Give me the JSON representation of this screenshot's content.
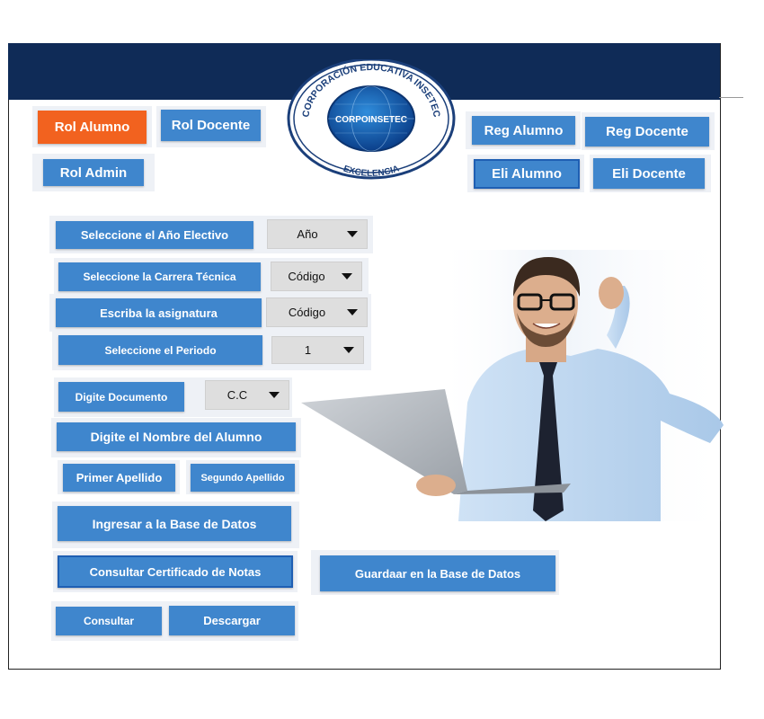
{
  "logo": {
    "top_arc_text": "CORPORACIÓN EDUCATIVA INSETEC",
    "center_text": "CORPOINSETEC",
    "bottom_arc_text": "EXCELENCIA"
  },
  "roles": {
    "alumno": "Rol  Alumno",
    "docente": "Rol Docente",
    "admin": "Rol Admin"
  },
  "registry": {
    "reg_alumno": "Reg Alumno",
    "reg_docente": "Reg  Docente",
    "eli_alumno": "Eli  Alumno",
    "eli_docente": "Eli  Docente"
  },
  "form": {
    "year_label": "Seleccione el Año Electivo",
    "year_value": "Año",
    "career_label": "Seleccione la Carrera Técnica",
    "career_value": "Código",
    "subject_label": "Escriba la asignatura",
    "subject_value": "Código",
    "period_label": "Seleccione el Periodo",
    "period_value": "1",
    "doc_label": "Digite Documento",
    "doc_value": "C.C",
    "name_label": "Digite el Nombre del Alumno",
    "first_last_label": "Primer Apellido",
    "second_last_label": "Segundo Apellido"
  },
  "actions": {
    "ingresar": "Ingresar a la Base de Datos",
    "consultar_cert": "Consultar Certificado de Notas",
    "guardar": "Guardaar en la Base de Datos",
    "consultar": "Consultar",
    "descargar": "Descargar"
  },
  "colors": {
    "header": "#0f2b57",
    "button": "#3f86cd",
    "active_button": "#f2621f"
  }
}
